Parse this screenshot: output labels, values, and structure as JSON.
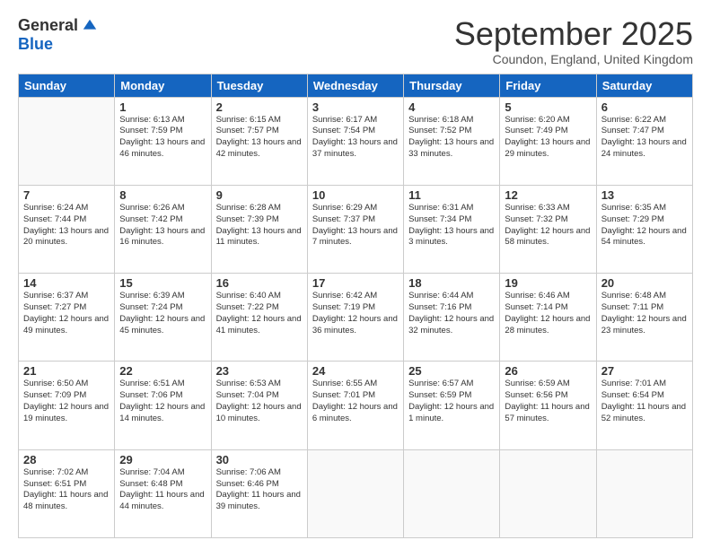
{
  "logo": {
    "general": "General",
    "blue": "Blue"
  },
  "header": {
    "month": "September 2025",
    "location": "Coundon, England, United Kingdom"
  },
  "days_of_week": [
    "Sunday",
    "Monday",
    "Tuesday",
    "Wednesday",
    "Thursday",
    "Friday",
    "Saturday"
  ],
  "weeks": [
    [
      {
        "day": "",
        "sunrise": "",
        "sunset": "",
        "daylight": ""
      },
      {
        "day": "1",
        "sunrise": "Sunrise: 6:13 AM",
        "sunset": "Sunset: 7:59 PM",
        "daylight": "Daylight: 13 hours and 46 minutes."
      },
      {
        "day": "2",
        "sunrise": "Sunrise: 6:15 AM",
        "sunset": "Sunset: 7:57 PM",
        "daylight": "Daylight: 13 hours and 42 minutes."
      },
      {
        "day": "3",
        "sunrise": "Sunrise: 6:17 AM",
        "sunset": "Sunset: 7:54 PM",
        "daylight": "Daylight: 13 hours and 37 minutes."
      },
      {
        "day": "4",
        "sunrise": "Sunrise: 6:18 AM",
        "sunset": "Sunset: 7:52 PM",
        "daylight": "Daylight: 13 hours and 33 minutes."
      },
      {
        "day": "5",
        "sunrise": "Sunrise: 6:20 AM",
        "sunset": "Sunset: 7:49 PM",
        "daylight": "Daylight: 13 hours and 29 minutes."
      },
      {
        "day": "6",
        "sunrise": "Sunrise: 6:22 AM",
        "sunset": "Sunset: 7:47 PM",
        "daylight": "Daylight: 13 hours and 24 minutes."
      }
    ],
    [
      {
        "day": "7",
        "sunrise": "Sunrise: 6:24 AM",
        "sunset": "Sunset: 7:44 PM",
        "daylight": "Daylight: 13 hours and 20 minutes."
      },
      {
        "day": "8",
        "sunrise": "Sunrise: 6:26 AM",
        "sunset": "Sunset: 7:42 PM",
        "daylight": "Daylight: 13 hours and 16 minutes."
      },
      {
        "day": "9",
        "sunrise": "Sunrise: 6:28 AM",
        "sunset": "Sunset: 7:39 PM",
        "daylight": "Daylight: 13 hours and 11 minutes."
      },
      {
        "day": "10",
        "sunrise": "Sunrise: 6:29 AM",
        "sunset": "Sunset: 7:37 PM",
        "daylight": "Daylight: 13 hours and 7 minutes."
      },
      {
        "day": "11",
        "sunrise": "Sunrise: 6:31 AM",
        "sunset": "Sunset: 7:34 PM",
        "daylight": "Daylight: 13 hours and 3 minutes."
      },
      {
        "day": "12",
        "sunrise": "Sunrise: 6:33 AM",
        "sunset": "Sunset: 7:32 PM",
        "daylight": "Daylight: 12 hours and 58 minutes."
      },
      {
        "day": "13",
        "sunrise": "Sunrise: 6:35 AM",
        "sunset": "Sunset: 7:29 PM",
        "daylight": "Daylight: 12 hours and 54 minutes."
      }
    ],
    [
      {
        "day": "14",
        "sunrise": "Sunrise: 6:37 AM",
        "sunset": "Sunset: 7:27 PM",
        "daylight": "Daylight: 12 hours and 49 minutes."
      },
      {
        "day": "15",
        "sunrise": "Sunrise: 6:39 AM",
        "sunset": "Sunset: 7:24 PM",
        "daylight": "Daylight: 12 hours and 45 minutes."
      },
      {
        "day": "16",
        "sunrise": "Sunrise: 6:40 AM",
        "sunset": "Sunset: 7:22 PM",
        "daylight": "Daylight: 12 hours and 41 minutes."
      },
      {
        "day": "17",
        "sunrise": "Sunrise: 6:42 AM",
        "sunset": "Sunset: 7:19 PM",
        "daylight": "Daylight: 12 hours and 36 minutes."
      },
      {
        "day": "18",
        "sunrise": "Sunrise: 6:44 AM",
        "sunset": "Sunset: 7:16 PM",
        "daylight": "Daylight: 12 hours and 32 minutes."
      },
      {
        "day": "19",
        "sunrise": "Sunrise: 6:46 AM",
        "sunset": "Sunset: 7:14 PM",
        "daylight": "Daylight: 12 hours and 28 minutes."
      },
      {
        "day": "20",
        "sunrise": "Sunrise: 6:48 AM",
        "sunset": "Sunset: 7:11 PM",
        "daylight": "Daylight: 12 hours and 23 minutes."
      }
    ],
    [
      {
        "day": "21",
        "sunrise": "Sunrise: 6:50 AM",
        "sunset": "Sunset: 7:09 PM",
        "daylight": "Daylight: 12 hours and 19 minutes."
      },
      {
        "day": "22",
        "sunrise": "Sunrise: 6:51 AM",
        "sunset": "Sunset: 7:06 PM",
        "daylight": "Daylight: 12 hours and 14 minutes."
      },
      {
        "day": "23",
        "sunrise": "Sunrise: 6:53 AM",
        "sunset": "Sunset: 7:04 PM",
        "daylight": "Daylight: 12 hours and 10 minutes."
      },
      {
        "day": "24",
        "sunrise": "Sunrise: 6:55 AM",
        "sunset": "Sunset: 7:01 PM",
        "daylight": "Daylight: 12 hours and 6 minutes."
      },
      {
        "day": "25",
        "sunrise": "Sunrise: 6:57 AM",
        "sunset": "Sunset: 6:59 PM",
        "daylight": "Daylight: 12 hours and 1 minute."
      },
      {
        "day": "26",
        "sunrise": "Sunrise: 6:59 AM",
        "sunset": "Sunset: 6:56 PM",
        "daylight": "Daylight: 11 hours and 57 minutes."
      },
      {
        "day": "27",
        "sunrise": "Sunrise: 7:01 AM",
        "sunset": "Sunset: 6:54 PM",
        "daylight": "Daylight: 11 hours and 52 minutes."
      }
    ],
    [
      {
        "day": "28",
        "sunrise": "Sunrise: 7:02 AM",
        "sunset": "Sunset: 6:51 PM",
        "daylight": "Daylight: 11 hours and 48 minutes."
      },
      {
        "day": "29",
        "sunrise": "Sunrise: 7:04 AM",
        "sunset": "Sunset: 6:48 PM",
        "daylight": "Daylight: 11 hours and 44 minutes."
      },
      {
        "day": "30",
        "sunrise": "Sunrise: 7:06 AM",
        "sunset": "Sunset: 6:46 PM",
        "daylight": "Daylight: 11 hours and 39 minutes."
      },
      {
        "day": "",
        "sunrise": "",
        "sunset": "",
        "daylight": ""
      },
      {
        "day": "",
        "sunrise": "",
        "sunset": "",
        "daylight": ""
      },
      {
        "day": "",
        "sunrise": "",
        "sunset": "",
        "daylight": ""
      },
      {
        "day": "",
        "sunrise": "",
        "sunset": "",
        "daylight": ""
      }
    ]
  ]
}
